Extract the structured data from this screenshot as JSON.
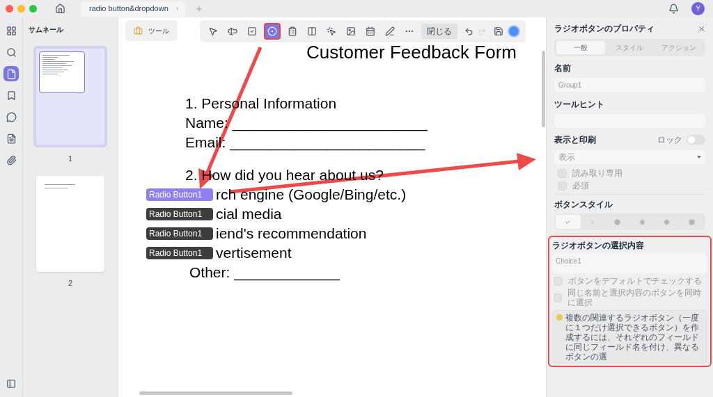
{
  "window": {
    "tab_title": "radio button&dropdown",
    "avatar": "Y"
  },
  "rail": [
    {
      "kind": "grid",
      "selected": false
    },
    {
      "kind": "search",
      "selected": false
    },
    {
      "kind": "page",
      "selected": true
    },
    {
      "kind": "bookmark",
      "selected": false
    },
    {
      "kind": "comment",
      "selected": false
    },
    {
      "kind": "form",
      "selected": false
    },
    {
      "kind": "attachment",
      "selected": false
    }
  ],
  "thumbnails": {
    "title": "サムネール",
    "pages": [
      {
        "number": "1",
        "selected": true,
        "kind": "form"
      },
      {
        "number": "2",
        "selected": false,
        "kind": "dropdown"
      }
    ]
  },
  "tools_button": "ツール",
  "toolbar": {
    "items": [
      {
        "kind": "select",
        "selected": false
      },
      {
        "kind": "text-field",
        "selected": false
      },
      {
        "kind": "checkbox",
        "selected": false
      },
      {
        "kind": "radio",
        "selected": true
      },
      {
        "kind": "combo",
        "selected": false
      },
      {
        "kind": "list",
        "selected": false
      },
      {
        "kind": "button",
        "selected": false
      },
      {
        "kind": "image",
        "selected": false
      },
      {
        "kind": "date",
        "selected": false
      },
      {
        "kind": "signature",
        "selected": false
      },
      {
        "kind": "more",
        "selected": false
      }
    ],
    "close": "閉じる"
  },
  "document": {
    "title": "Customer Feedback Form",
    "lines": [
      "1. Personal Information",
      "Name: ________________________",
      "Email: ________________________"
    ],
    "question": "2. How did you hear about us?",
    "options": [
      {
        "field_label": "Radio Button1",
        "selected": true,
        "text": "rch engine (Google/Bing/etc.)"
      },
      {
        "field_label": "Radio Button1",
        "selected": false,
        "text": "cial media"
      },
      {
        "field_label": "Radio Button1",
        "selected": false,
        "text": "iend's recommendation"
      },
      {
        "field_label": "Radio Button1",
        "selected": false,
        "text": "vertisement"
      }
    ],
    "other": "Other: _____________"
  },
  "panel": {
    "title": "ラジオボタンのプロパティ",
    "tabs": [
      {
        "label": "一般",
        "selected": true
      },
      {
        "label": "スタイル",
        "selected": false
      },
      {
        "label": "アクション",
        "selected": false
      }
    ],
    "name_label": "名前",
    "name_value": "Group1",
    "tooltip_label": "ツールヒント",
    "display_label": "表示と印刷",
    "lock_label": "ロック",
    "lock_on": false,
    "display_value": "表示",
    "checkboxes": [
      {
        "label": "読み取り専用",
        "checked": false
      },
      {
        "label": "必須",
        "checked": false
      }
    ],
    "style_label": "ボタンスタイル",
    "styles": [
      {
        "kind": "check",
        "selected": true
      },
      {
        "kind": "cross",
        "selected": false
      },
      {
        "kind": "circle",
        "selected": false
      },
      {
        "kind": "star",
        "selected": false
      },
      {
        "kind": "diamond",
        "selected": false
      },
      {
        "kind": "square",
        "selected": false
      }
    ],
    "choice_label": "ラジオボタンの選択内容",
    "choice_value": "Choice1",
    "choice_checkboxes": [
      {
        "label": "ボタンをデフォルトでチェックする",
        "checked": false
      },
      {
        "label": "同じ名前と選択内容のボタンを同時に選択",
        "checked": false
      }
    ],
    "note": "複数の関連するラジオボタン（一度に１つだけ選択できるボタン）を作成するには、それぞれのフィールドに同じフィールド名を付け、異なるボタンの選"
  }
}
